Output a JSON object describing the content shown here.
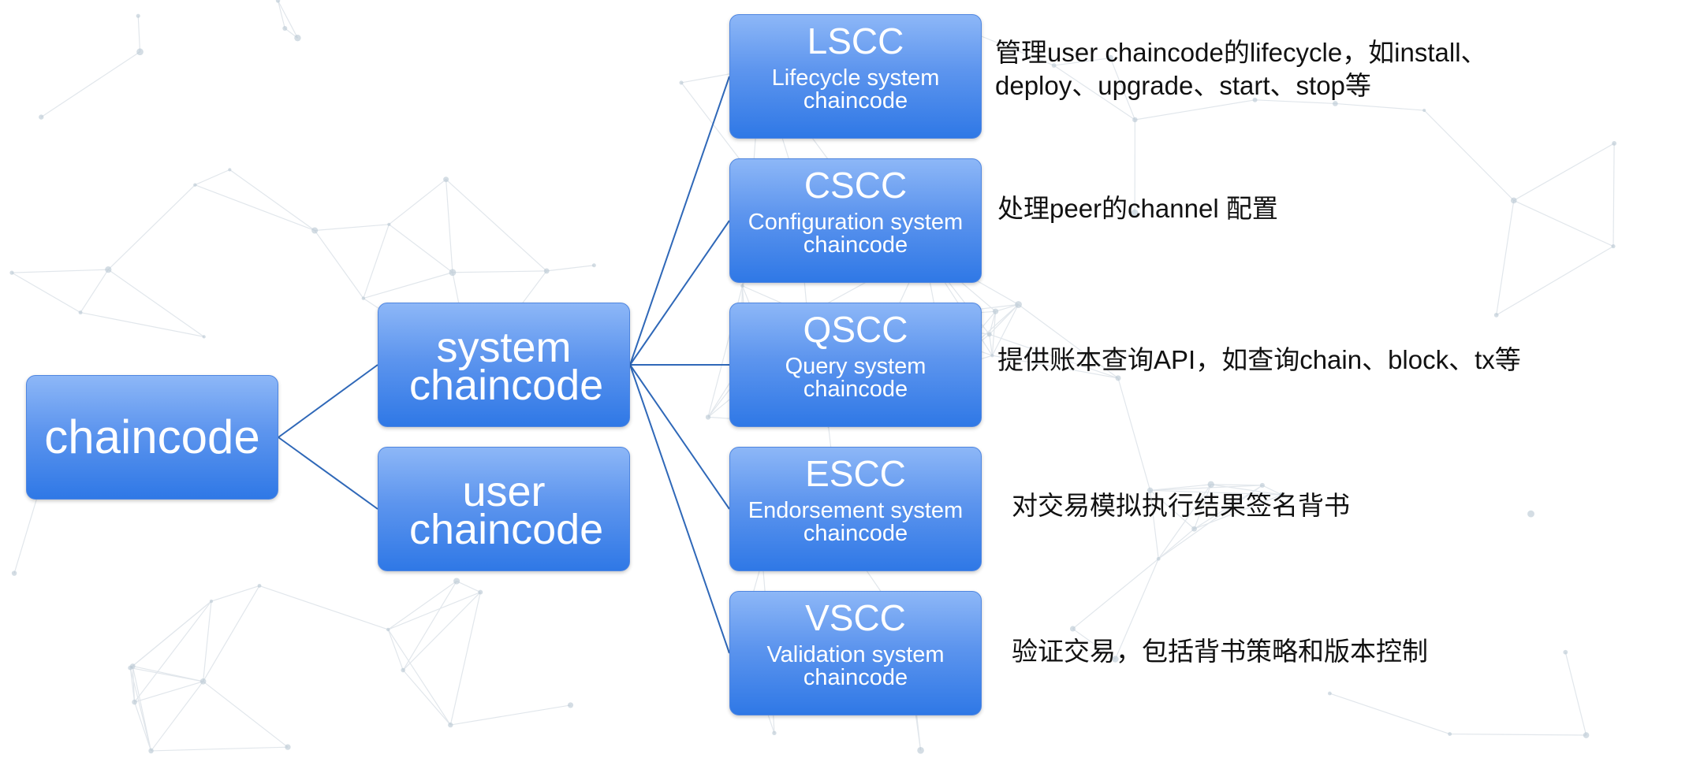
{
  "root": {
    "label": "chaincode"
  },
  "groups": [
    {
      "id": "system",
      "label": "system chaincode"
    },
    {
      "id": "user",
      "label": "user chaincode"
    }
  ],
  "system_children": [
    {
      "id": "lscc",
      "title": "LSCC",
      "subtitle": "Lifecycle system chaincode",
      "description": [
        "管理user chaincode的lifecycle，如install、",
        "deploy、upgrade、start、stop等"
      ]
    },
    {
      "id": "cscc",
      "title": "CSCC",
      "subtitle": "Configuration system chaincode",
      "description": [
        "处理peer的channel 配置"
      ]
    },
    {
      "id": "qscc",
      "title": "QSCC",
      "subtitle": "Query system chaincode",
      "description": [
        "提供账本查询API，如查询chain、block、tx等"
      ]
    },
    {
      "id": "escc",
      "title": "ESCC",
      "subtitle": "Endorsement system chaincode",
      "description": [
        "对交易模拟执行结果签名背书"
      ]
    },
    {
      "id": "vscc",
      "title": "VSCC",
      "subtitle": "Validation system chaincode",
      "description": [
        "验证交易，包括背书策略和版本控制"
      ]
    }
  ],
  "colors": {
    "box_top": "#8db7f7",
    "box_bottom": "#2f78e6",
    "connector": "#2f68b8"
  }
}
